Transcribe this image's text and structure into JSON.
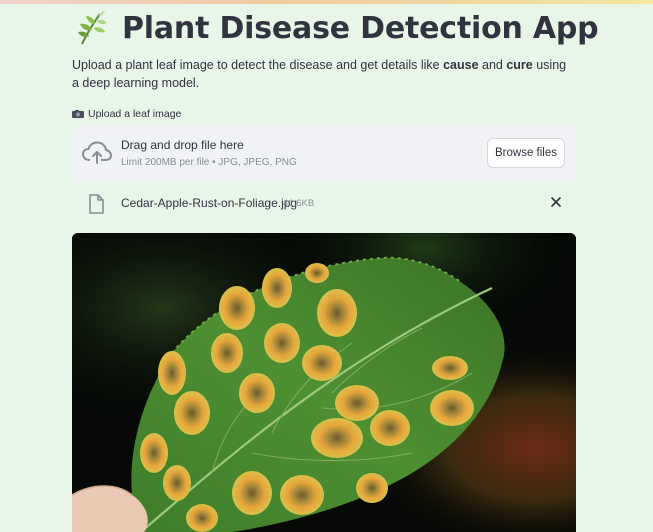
{
  "app": {
    "title": "Plant Disease Detection App",
    "title_icon": "herb-icon",
    "description": {
      "part1": "Upload a plant leaf image to detect the disease and get details like ",
      "bold1": "cause",
      "part2": " and ",
      "bold2": "cure",
      "part3": " using a deep learning model."
    }
  },
  "uploader": {
    "label": "Upload a leaf image",
    "label_icon": "camera-icon",
    "drop_title": "Drag and drop file here",
    "drop_limit": "Limit 200MB per file • JPG, JPEG, PNG",
    "browse_label": "Browse files",
    "upload_icon": "cloud-upload-icon"
  },
  "uploaded_file": {
    "name": "Cedar-Apple-Rust-on-Foliage.jpg",
    "size": "41.6KB",
    "file_icon": "file-icon",
    "remove_icon": "close-icon"
  },
  "preview": {
    "subject": "leaf-with-rust-spots"
  },
  "colors": {
    "background": "#e8f5e9",
    "dropzone": "#f0f2f6",
    "text": "#31333f",
    "muted": "#8a8d97"
  }
}
